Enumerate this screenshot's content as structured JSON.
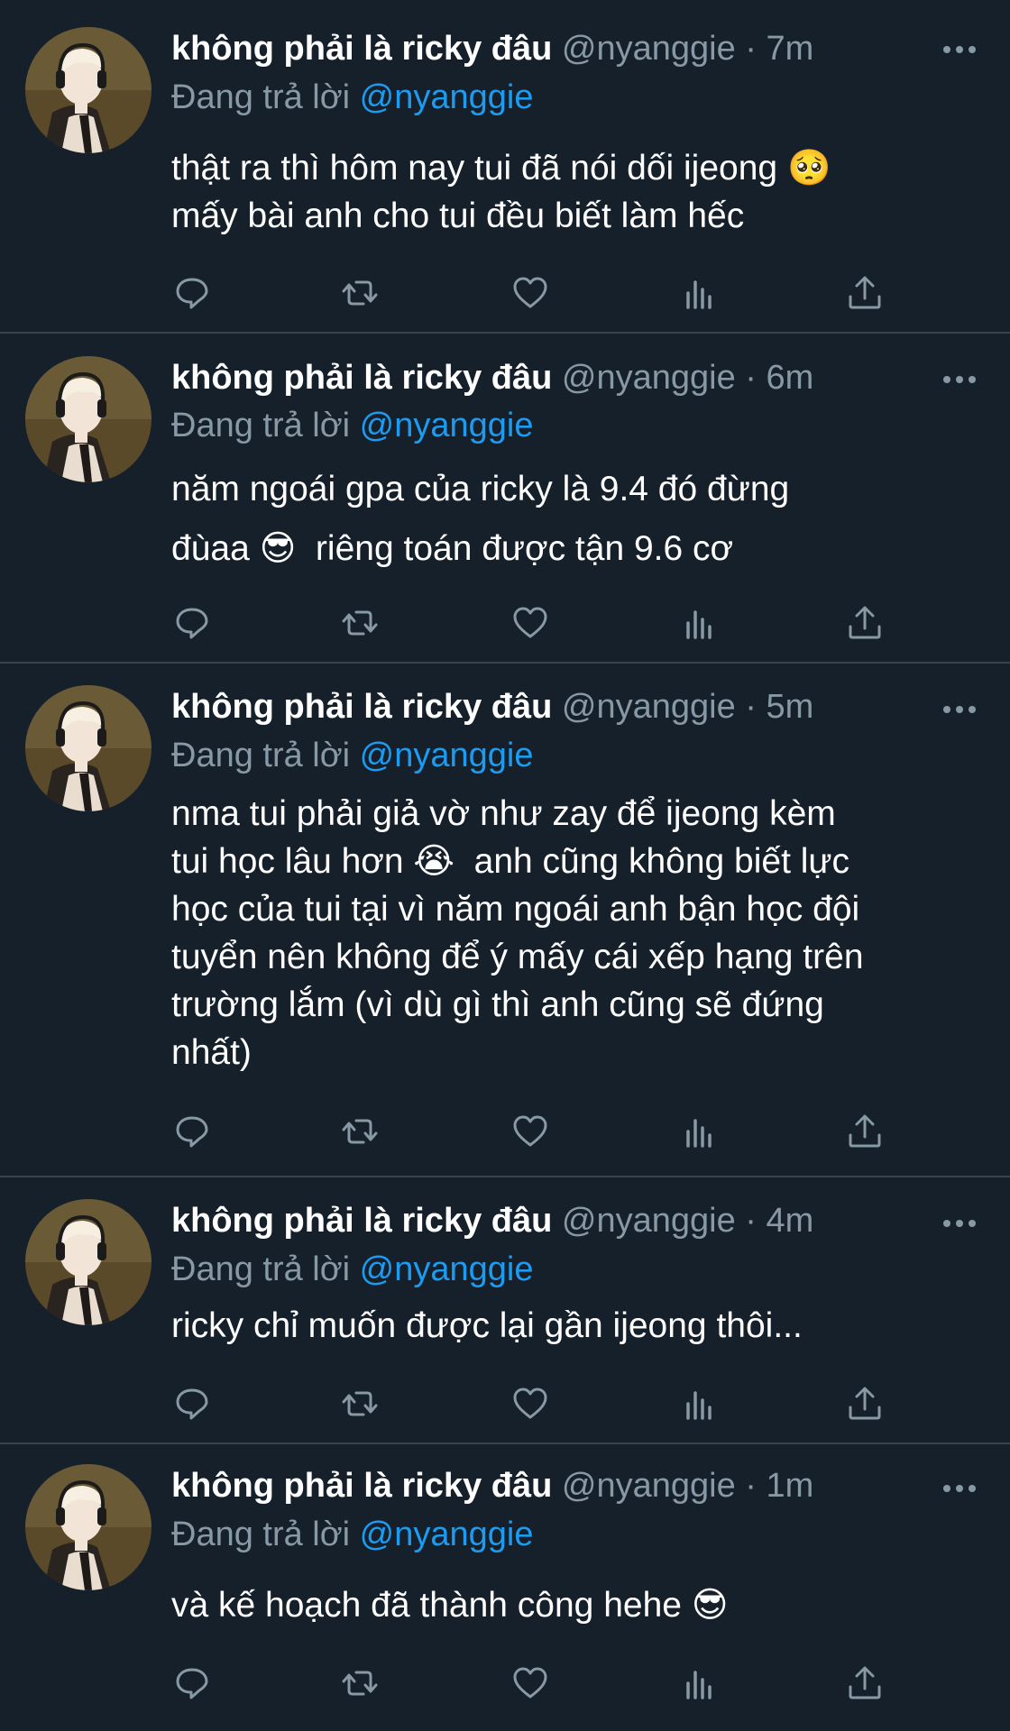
{
  "author": {
    "display_name": "không phải là ricky đâu",
    "handle": "@nyanggie",
    "avatar": "avatar-boy-with-headphones"
  },
  "reply_prefix": "Đang trả lời",
  "reply_to": "@nyanggie",
  "separator": "·",
  "colors": {
    "background": "#15202b",
    "secondary_text": "#8899a6",
    "accent": "#1d9bf0",
    "divider": "#38444d"
  },
  "action_icons": [
    "reply-icon",
    "retweet-icon",
    "like-icon",
    "analytics-icon",
    "share-icon"
  ],
  "tweets": [
    {
      "time": "7m",
      "text": "thật ra thì hôm nay tui đã nói dối ijeong 🥺\nmấy bài anh cho tui đều biết làm hếc"
    },
    {
      "time": "6m",
      "text": "năm ngoái gpa của ricky là 9.4 đó đừng\nđùaa 😎  riêng toán được tận 9.6 cơ"
    },
    {
      "time": "5m",
      "text": "nma tui phải giả vờ như zay để ijeong kèm\ntui học lâu hơn 😭  anh cũng không biết lực\nhọc của tui tại vì năm ngoái anh bận học đội\ntuyển nên không để ý mấy cái xếp hạng trên\ntrường lắm (vì dù gì thì anh cũng sẽ đứng\nnhất)"
    },
    {
      "time": "4m",
      "text": "ricky chỉ muốn được lại gần ijeong thôi..."
    },
    {
      "time": "1m",
      "text": "và kế hoạch đã thành công hehe 😎"
    }
  ]
}
